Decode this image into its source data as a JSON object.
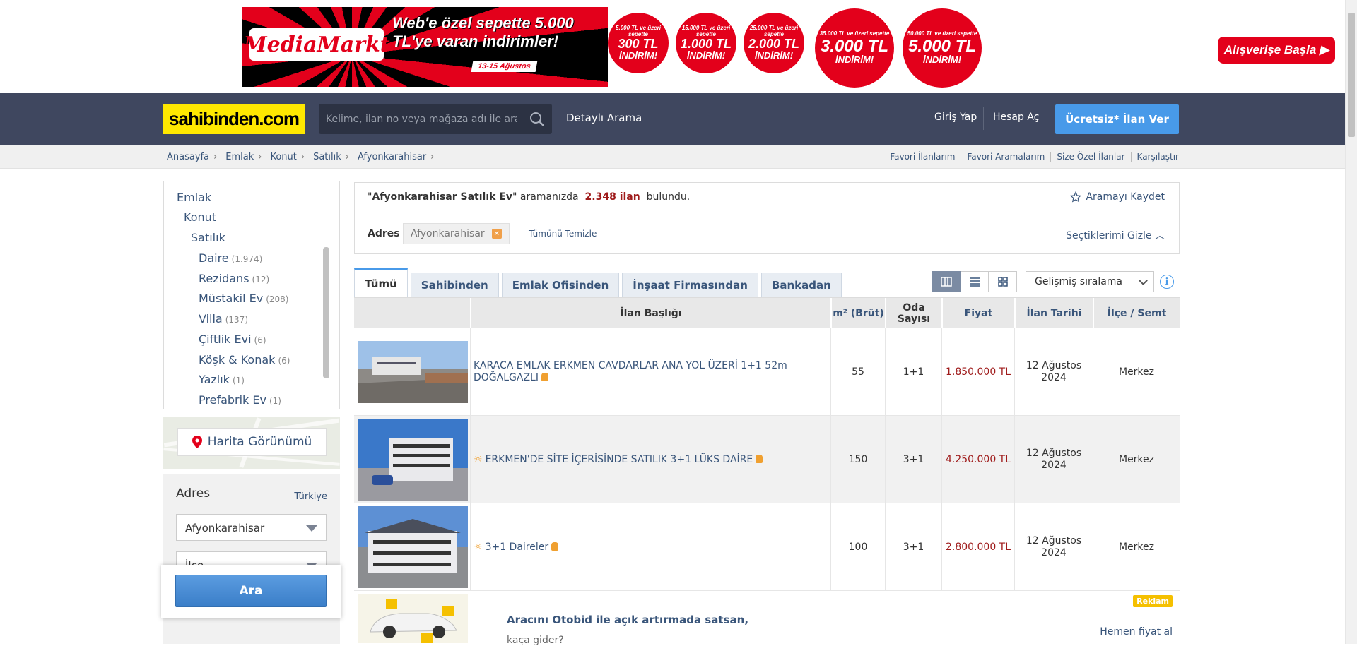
{
  "banner": {
    "logo_text": "MediaMarkt",
    "headline": "Web'e özel sepette 5.000 TL'ye varan indirimler!",
    "dates": "13-15 Ağustos",
    "discounts": [
      {
        "threshold": "5.000 TL ve üzeri sepette",
        "amount": "300 TL",
        "label": "İNDİRİM!"
      },
      {
        "threshold": "15.000 TL ve üzeri sepette",
        "amount": "1.000 TL",
        "label": "İNDİRİM!"
      },
      {
        "threshold": "25.000 TL ve üzeri sepette",
        "amount": "2.000 TL",
        "label": "İNDİRİM!"
      },
      {
        "threshold": "35.000 TL ve üzeri sepette",
        "amount": "3.000 TL",
        "label": "İNDİRİM!"
      },
      {
        "threshold": "50.000 TL ve üzeri sepette",
        "amount": "5.000 TL",
        "label": "İNDİRİM!"
      }
    ],
    "cta": "Alışverişe Başla",
    "brand_color": "#e3001b"
  },
  "header": {
    "logo": "sahibinden.com",
    "search_placeholder": "Kelime, ilan no veya mağaza adı ile ara",
    "detailed_search": "Detaylı Arama",
    "login": "Giriş Yap",
    "register": "Hesap Aç",
    "post_ad": "Ücretsiz* İlan Ver",
    "bg_color": "#3f475f",
    "accent_color": "#489ae9"
  },
  "breadcrumb": [
    "Anasayfa",
    "Emlak",
    "Konut",
    "Satılık",
    "Afyonkarahisar"
  ],
  "top_links": [
    "Favori İlanlarım",
    "Favori Aramalarım",
    "Size Özel İlanlar",
    "Karşılaştır"
  ],
  "sidebar": {
    "categories": [
      {
        "label": "Emlak",
        "count": ""
      },
      {
        "label": "Konut",
        "count": ""
      },
      {
        "label": "Satılık",
        "count": ""
      },
      {
        "label": "Daire",
        "count": "(1.974)"
      },
      {
        "label": "Rezidans",
        "count": "(12)"
      },
      {
        "label": "Müstakil Ev",
        "count": "(208)"
      },
      {
        "label": "Villa",
        "count": "(137)"
      },
      {
        "label": "Çiftlik Evi",
        "count": "(6)"
      },
      {
        "label": "Köşk & Konak",
        "count": "(6)"
      },
      {
        "label": "Yazlık",
        "count": "(1)"
      },
      {
        "label": "Prefabrik Ev",
        "count": "(1)"
      }
    ],
    "map_button": "Harita Görünümü",
    "address_title": "Adres",
    "address_country": "Türkiye",
    "province_value": "Afyonkarahisar",
    "district_placeholder": "İlçe",
    "search_button": "Ara"
  },
  "summary": {
    "query": "Afyonkarahisar Satılık Ev",
    "text_mid": "aramanızda",
    "count": "2.348 ilan",
    "text_end": "bulundu.",
    "save_search": "Aramayı Kaydet",
    "filter_label": "Adres",
    "filter_chip": "Afyonkarahisar",
    "clear_all": "Tümünü Temizle",
    "hide_selected": "Seçtiklerimi Gizle"
  },
  "tabs": [
    "Tümü",
    "Sahibinden",
    "Emlak Ofisinden",
    "İnşaat Firmasından",
    "Bankadan"
  ],
  "sort": {
    "value": "Gelişmiş sıralama"
  },
  "table": {
    "headers": [
      "İlan Başlığı",
      "m² (Brüt)",
      "Oda Sayısı",
      "Fiyat",
      "İlan Tarihi",
      "İlçe / Semt"
    ],
    "rows": [
      {
        "title": "KARACA EMLAK ERKMEN CAVDARLAR ANA YOL ÜZERİ 1+1 52m DOĞALGAZLI",
        "m2": "55",
        "rooms": "1+1",
        "price": "1.850.000 TL",
        "date": "12 Ağustos 2024",
        "district": "Merkez",
        "featured": false
      },
      {
        "title": "ERKMEN'DE SİTE İÇERİSİNDE SATILIK 3+1 LÜKS DAİRE",
        "m2": "150",
        "rooms": "3+1",
        "price": "4.250.000 TL",
        "date": "12 Ağustos 2024",
        "district": "Merkez",
        "featured": true
      },
      {
        "title": "3+1 Daireler",
        "m2": "100",
        "rooms": "3+1",
        "price": "2.800.000 TL",
        "date": "12 Ağustos 2024",
        "district": "Merkez",
        "featured": true
      }
    ]
  },
  "ad_row": {
    "badge": "Reklam",
    "title": "Aracını Otobid ile açık artırmada satsan,",
    "subtitle": "kaça gider?",
    "link": "Hemen fiyat al"
  }
}
